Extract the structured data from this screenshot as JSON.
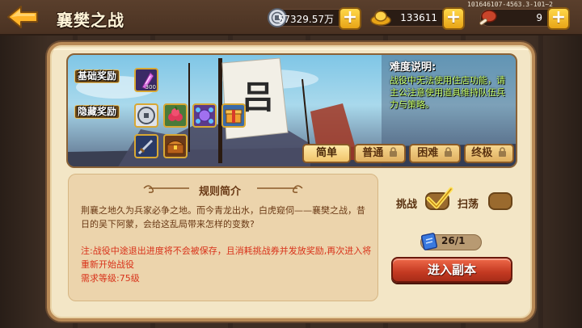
{
  "header": {
    "title": "襄樊之战",
    "build_id": "101646107-4563.3-101~2",
    "silver_value": "57329.57万",
    "gold_value": "133611",
    "stamina_value": "9"
  },
  "banner": {
    "base_reward_label": "基础奖励",
    "hidden_reward_label": "隐藏奖励",
    "base_item_count": "300",
    "difficulty_title": "难度说明:",
    "difficulty_text": "战役中无法使用住店功能，请主公注意使用道具维持队伍兵力与策略。",
    "tabs": [
      {
        "label": "简单",
        "locked": false,
        "active": true
      },
      {
        "label": "普通",
        "locked": true
      },
      {
        "label": "困难",
        "locked": true
      },
      {
        "label": "终极",
        "locked": true
      }
    ]
  },
  "rules": {
    "title": "规则简介",
    "body": "荆襄之地久为兵家必争之地。而今青龙出水，白虎窥伺——襄樊之战，昔日的吴下阿蒙，会给这乱局带来怎样的变数?",
    "note_line1": "注:战役中途退出进度将不会被保存，且消耗挑战券并发放奖励,再次进入将重新开始战役",
    "note_line2": "需求等级:75级"
  },
  "controls": {
    "challenge_label": "挑战",
    "sweep_label": "扫荡",
    "ticket_value": "26/1",
    "enter_label": "进入副本"
  },
  "colors": {
    "accent_red": "#c43a22",
    "gold": "#e8a416",
    "difficulty_text": "#c8ff6a",
    "note_red": "#d8321a"
  }
}
